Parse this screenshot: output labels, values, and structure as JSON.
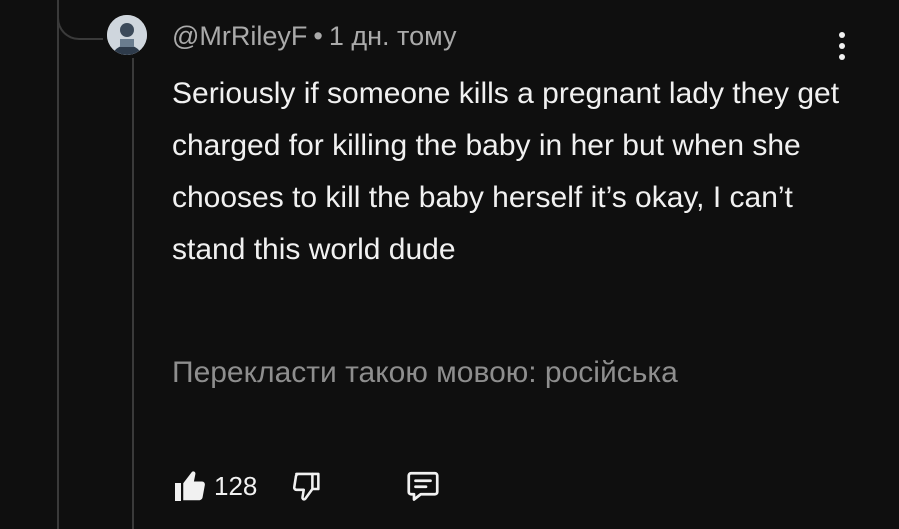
{
  "comment": {
    "author": "@MrRileyF",
    "separator": "•",
    "timestamp": "1 дн. тому",
    "text": "Seriously if someone kills a pregnant lady they get charged for killing the baby in her but when she chooses to kill the baby herself it’s okay, I can’t stand this world dude",
    "translate_label": "Перекласти такою мовою: російська",
    "like_count": "128"
  },
  "icons": {
    "avatar": "avatar",
    "menu": "more-vert-icon",
    "like": "thumbs-up-filled-icon",
    "dislike": "thumbs-down-outline-icon",
    "reply": "comment-reply-icon"
  },
  "colors": {
    "background": "#0f0f0f",
    "text_primary": "#f1f1f1",
    "text_secondary": "#aaaaaa",
    "text_translate": "#8e8e8e",
    "thread_line": "#3a3a3a"
  }
}
